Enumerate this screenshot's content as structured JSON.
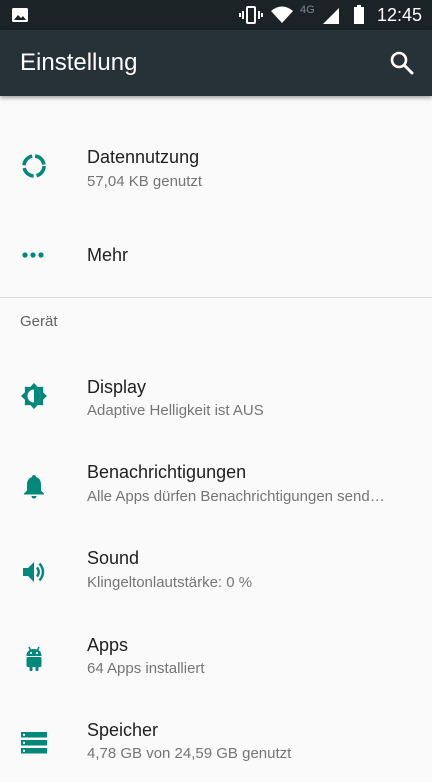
{
  "status_bar": {
    "network": "4G",
    "time": "12:45"
  },
  "app_bar": {
    "title": "Einstellung"
  },
  "items_top": [
    {
      "title": "Datennutzung",
      "subtitle": "57,04 KB genutzt",
      "icon": "data-usage-icon"
    },
    {
      "title": "Mehr",
      "subtitle": "",
      "icon": "more-icon"
    }
  ],
  "section": {
    "header": "Gerät"
  },
  "items_device": [
    {
      "title": "Display",
      "subtitle": "Adaptive Helligkeit ist AUS",
      "icon": "brightness-icon"
    },
    {
      "title": "Benachrichtigungen",
      "subtitle": "Alle Apps dürfen Benachrichtigungen send…",
      "icon": "bell-icon"
    },
    {
      "title": "Sound",
      "subtitle": "Klingeltonlautstärke: 0 %",
      "icon": "volume-icon"
    },
    {
      "title": "Apps",
      "subtitle": "64 Apps installiert",
      "icon": "android-icon"
    },
    {
      "title": "Speicher",
      "subtitle": "4,78 GB von 24,59 GB genutzt",
      "icon": "storage-icon"
    }
  ],
  "colors": {
    "accent": "#00897b",
    "app_bar": "#263238",
    "status_bar": "#1c2327"
  }
}
